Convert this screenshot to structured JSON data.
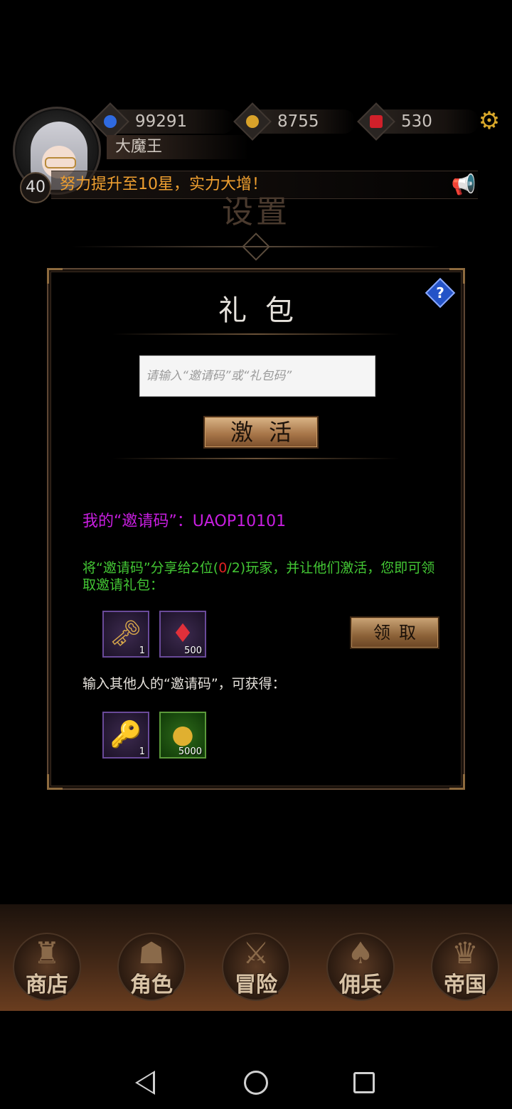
{
  "hud": {
    "level": "40",
    "player_name": "大魔王",
    "mana": "99291",
    "gold": "8755",
    "rubies": "530",
    "ticker_text": "努力提升至10星，实力大增！",
    "colors": {
      "ticker": "#f0a030",
      "settings_icon": "#d9a82a"
    }
  },
  "page": {
    "title": "设置"
  },
  "gift_panel": {
    "title": "礼包",
    "help_label": "?",
    "code_input": {
      "value": "",
      "placeholder": "请输入“邀请码”或“礼包码”"
    },
    "activate_label": "激活",
    "my_code_text": "我的“邀请码”：UAOP10101",
    "share_text_before": "将“邀请码”分享给2位(",
    "share_text_progress": "0",
    "share_text_after": "/2)玩家，并让他们激活，您即可领取邀请礼包：",
    "invite_rewards": [
      {
        "name": "keys",
        "icon": "keys-icon",
        "qty": "1"
      },
      {
        "name": "ruby",
        "icon": "ruby-icon",
        "qty": "500"
      }
    ],
    "claim_label": "领取",
    "others_text": "输入其他人的“邀请码”，可获得：",
    "input_rewards": [
      {
        "name": "key",
        "icon": "key-icon",
        "qty": "1"
      },
      {
        "name": "gold",
        "icon": "gold-coin-icon",
        "qty": "5000"
      }
    ],
    "colors": {
      "my_code": "#c81ee0",
      "share_text": "#43c734",
      "progress": "#e02020"
    }
  },
  "bottom_nav": {
    "items": [
      {
        "label": "商店",
        "icon": "castle-icon"
      },
      {
        "label": "角色",
        "icon": "hooded-figure-icon"
      },
      {
        "label": "冒险",
        "icon": "crossed-swords-icon"
      },
      {
        "label": "佣兵",
        "icon": "cards-icon"
      },
      {
        "label": "帝国",
        "icon": "crown-icon"
      }
    ]
  }
}
